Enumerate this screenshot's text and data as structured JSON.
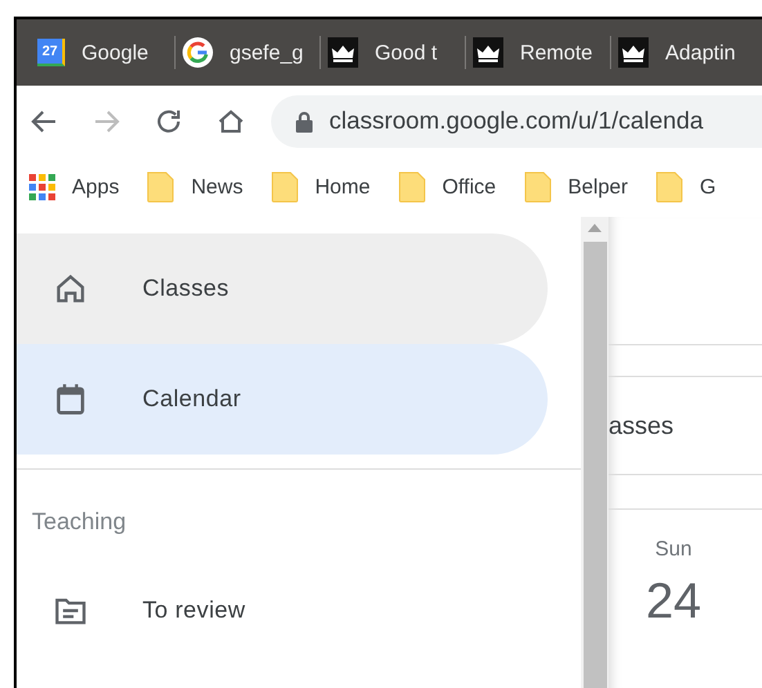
{
  "browser": {
    "tabs": [
      {
        "title": "Google",
        "kind": "calendar",
        "badge": "27"
      },
      {
        "title": "gsefe_g",
        "kind": "google"
      },
      {
        "title": "Good t",
        "kind": "crown"
      },
      {
        "title": "Remote",
        "kind": "crown"
      },
      {
        "title": "Adaptin",
        "kind": "crown"
      }
    ],
    "nav": [
      {
        "kind": "back",
        "disabled": false
      },
      {
        "kind": "forward",
        "disabled": true
      },
      {
        "kind": "reload",
        "disabled": false
      },
      {
        "kind": "home",
        "disabled": false
      }
    ],
    "url": "classroom.google.com/u/1/calenda",
    "bookmarks": [
      {
        "label": "Apps",
        "kind": "apps"
      },
      {
        "label": "News",
        "kind": "folder"
      },
      {
        "label": "Home",
        "kind": "folder"
      },
      {
        "label": "Office",
        "kind": "folder"
      },
      {
        "label": "Belper",
        "kind": "folder"
      },
      {
        "label": "G",
        "kind": "folder"
      }
    ]
  },
  "sidebar": {
    "items": [
      {
        "label": "Classes",
        "kind": "home",
        "selected": false,
        "hovered": true
      },
      {
        "label": "Calendar",
        "kind": "calendar",
        "selected": true,
        "hovered": false
      }
    ],
    "sections": [
      {
        "heading": "Teaching",
        "items": [
          {
            "label": "To review",
            "kind": "review",
            "selected": false,
            "hovered": false
          }
        ]
      }
    ]
  },
  "main": {
    "class_filter": "asses",
    "day": {
      "weekday": "Sun",
      "date": "24"
    }
  }
}
